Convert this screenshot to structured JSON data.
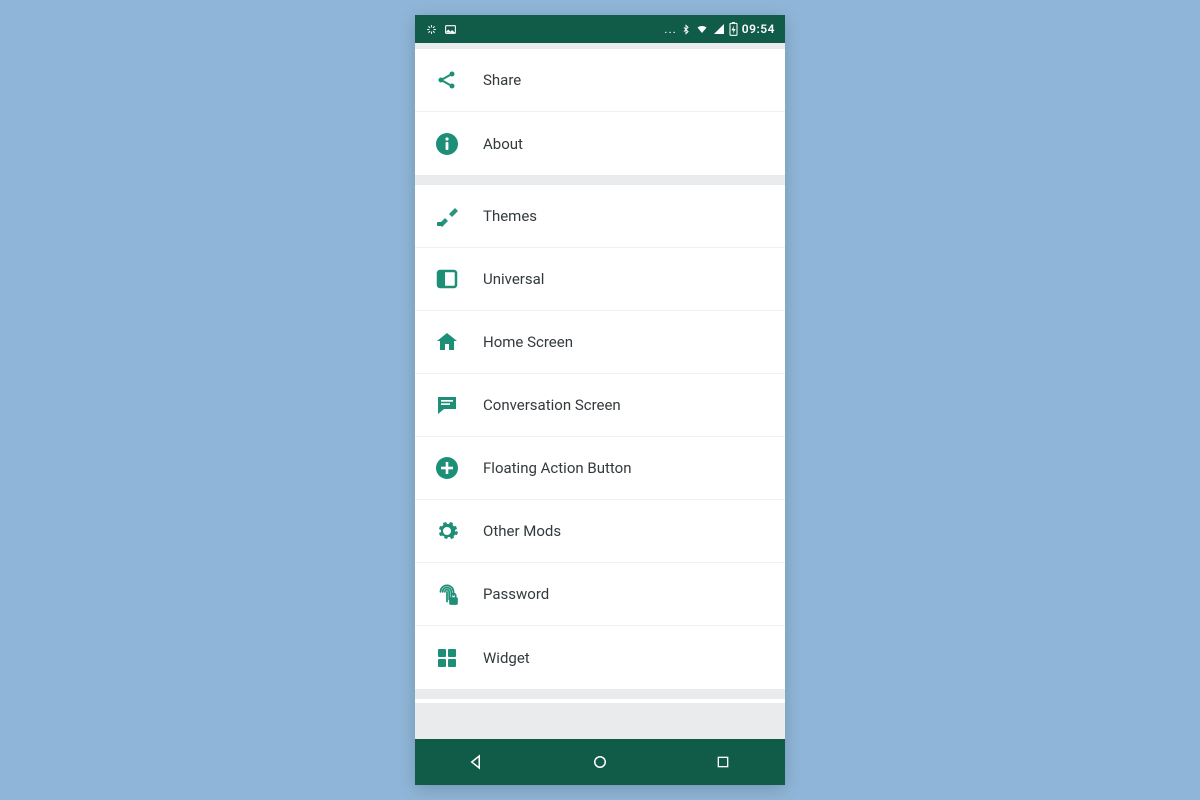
{
  "statusbar": {
    "time": "09:54"
  },
  "group1": [
    {
      "label": "Share",
      "icon": "share"
    },
    {
      "label": "About",
      "icon": "info"
    }
  ],
  "group2": [
    {
      "label": "Themes",
      "icon": "themes"
    },
    {
      "label": "Universal",
      "icon": "universal"
    },
    {
      "label": "Home Screen",
      "icon": "home"
    },
    {
      "label": "Conversation Screen",
      "icon": "chat"
    },
    {
      "label": "Floating Action Button",
      "icon": "plus"
    },
    {
      "label": "Other Mods",
      "icon": "gear"
    },
    {
      "label": "Password",
      "icon": "fingerprint"
    },
    {
      "label": "Widget",
      "icon": "widget"
    }
  ],
  "colors": {
    "accent": "#1e8f77",
    "bar": "#115c49"
  }
}
